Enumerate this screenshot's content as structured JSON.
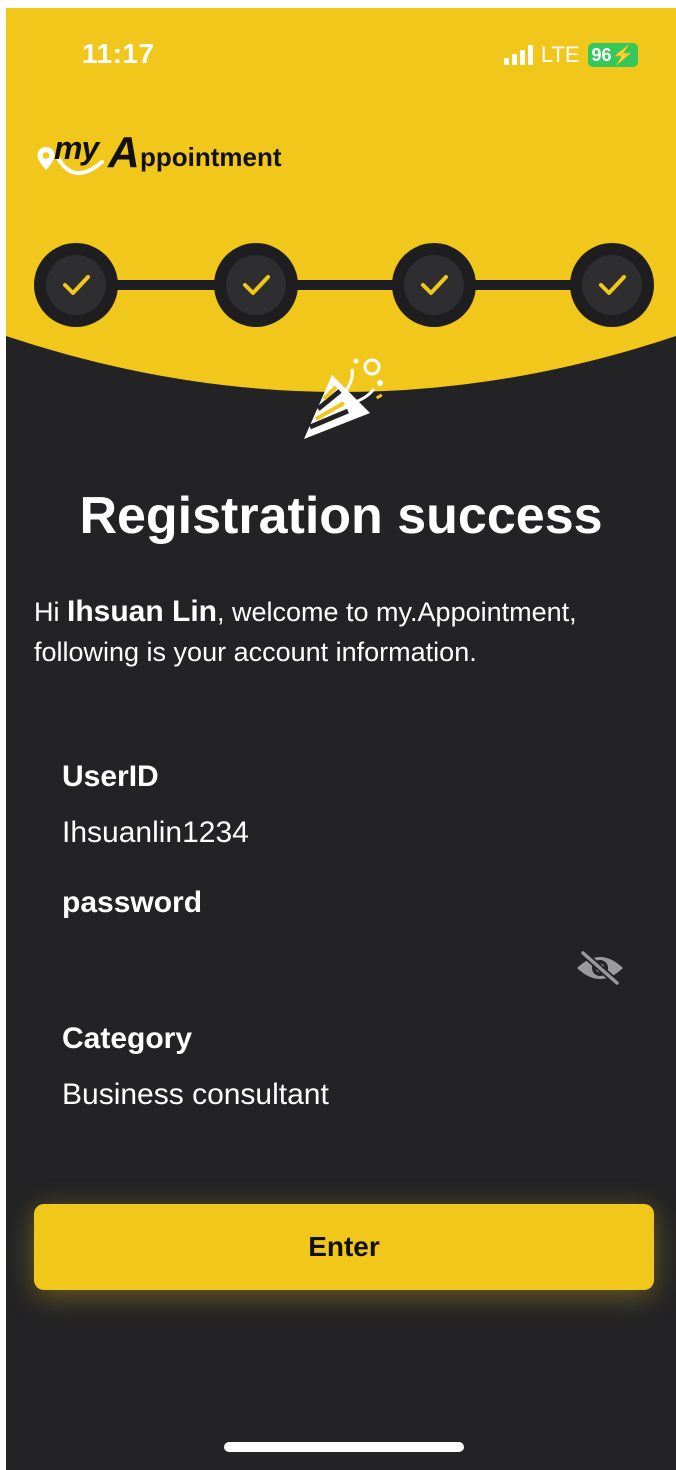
{
  "status_bar": {
    "time": "11:17",
    "network": "LTE",
    "battery": "96"
  },
  "brand": {
    "my": "my",
    "A": "A",
    "rest": "ppointment"
  },
  "steps": {
    "total": 4,
    "completed": 4
  },
  "page": {
    "title": "Registration success",
    "greeting_prefix": "Hi ",
    "user_name": "Ihsuan Lin",
    "greeting_suffix": ", welcome to my.Appointment, following is your account information."
  },
  "account": {
    "userid_label": "UserID",
    "userid_value": "Ihsuanlin1234",
    "password_label": "password",
    "category_label": "Category",
    "category_value": "Business consultant"
  },
  "actions": {
    "enter_label": "Enter"
  },
  "colors": {
    "accent_yellow": "#F2C71C",
    "background_dark": "#232325",
    "step_circle": "#1E1E20",
    "battery_green": "#34C759"
  }
}
